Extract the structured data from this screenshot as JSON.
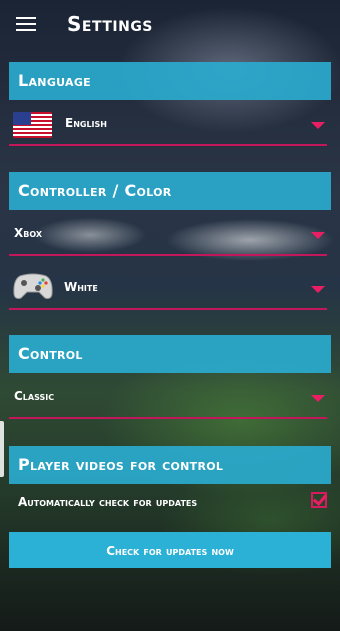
{
  "header": {
    "title": "Settings",
    "menu_icon": "hamburger-menu-icon"
  },
  "language": {
    "section_title": "Language",
    "selected": "English",
    "flag_icon": "us-flag-icon"
  },
  "controller": {
    "section_title": "Controller / Color",
    "controller_selected": "Xbox",
    "color_selected": "White",
    "controller_icon": "gamepad-icon"
  },
  "control": {
    "section_title": "Control",
    "selected": "Classic"
  },
  "player_videos": {
    "section_title": "Player videos for control",
    "auto_check_label": "Automatically check for updates",
    "auto_check_enabled": true,
    "update_button_label": "Check for updates now"
  },
  "colors": {
    "section_header_bg": "#2aaace",
    "accent": "#e91e63",
    "button_bg": "#2bb0d6"
  }
}
